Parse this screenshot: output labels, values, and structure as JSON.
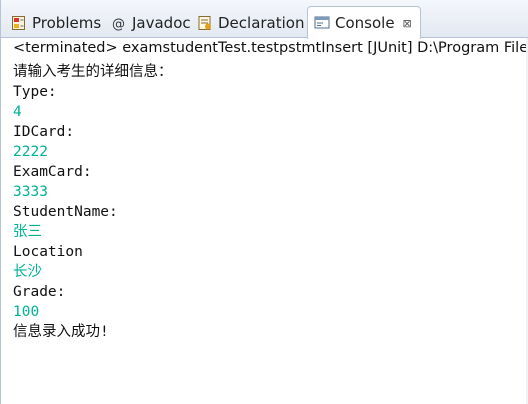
{
  "tabs": [
    {
      "label": "Problems",
      "icon": "problems-icon",
      "active": false
    },
    {
      "label": "Javadoc",
      "icon": "javadoc-icon",
      "active": false
    },
    {
      "label": "Declaration",
      "icon": "declaration-icon",
      "active": false
    },
    {
      "label": "Console",
      "icon": "console-icon",
      "active": true,
      "close": "⊠"
    }
  ],
  "status": "<terminated> examstudentTest.testpstmtInsert [JUnit] D:\\Program Files",
  "colors": {
    "output": "#111111",
    "input": "#00b294",
    "tab_border": "#b7c4d6"
  },
  "console": [
    {
      "text": "请输入考生的详细信息：",
      "kind": "output"
    },
    {
      "text": "Type:",
      "kind": "output"
    },
    {
      "text": "4",
      "kind": "input"
    },
    {
      "text": "IDCard:",
      "kind": "output"
    },
    {
      "text": "2222",
      "kind": "input"
    },
    {
      "text": "ExamCard:",
      "kind": "output"
    },
    {
      "text": "3333",
      "kind": "input"
    },
    {
      "text": "StudentName:",
      "kind": "output"
    },
    {
      "text": "张三",
      "kind": "input"
    },
    {
      "text": "Location",
      "kind": "output"
    },
    {
      "text": "长沙",
      "kind": "input"
    },
    {
      "text": "Grade:",
      "kind": "output"
    },
    {
      "text": "100",
      "kind": "input"
    },
    {
      "text": "信息录入成功!",
      "kind": "output"
    }
  ]
}
